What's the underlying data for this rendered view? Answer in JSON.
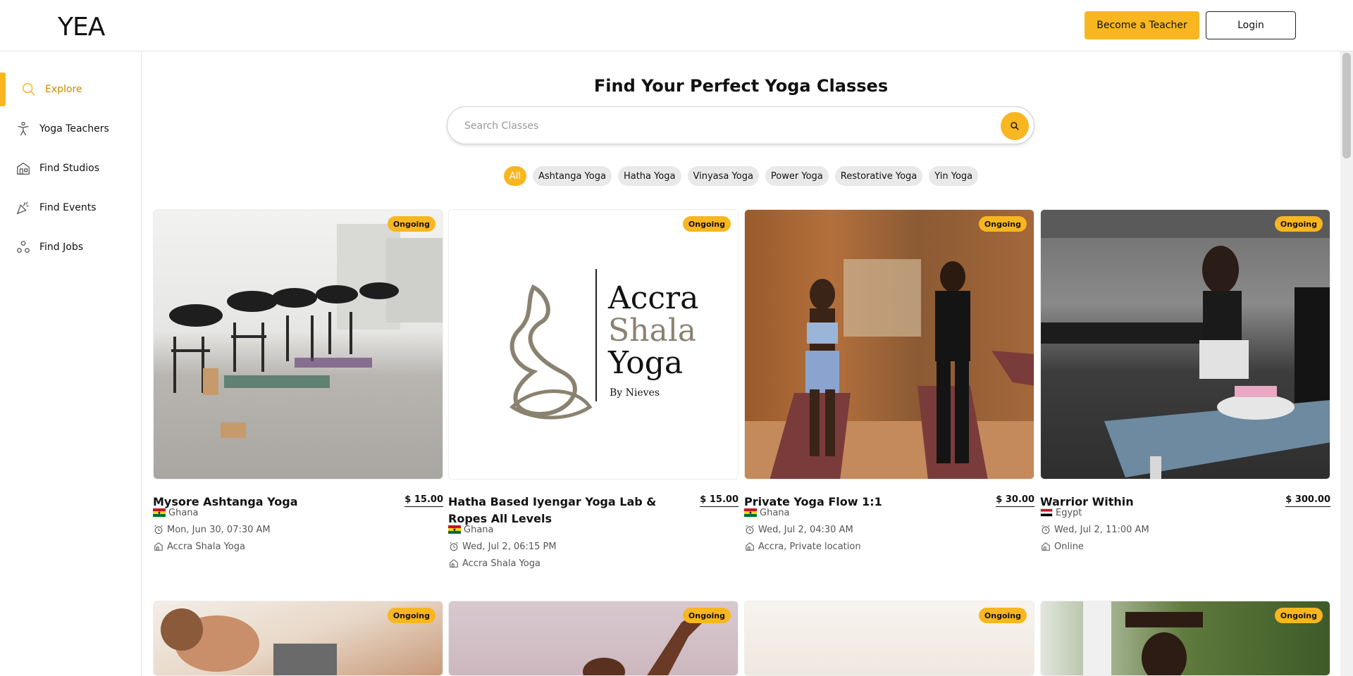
{
  "header": {
    "logo": "YEA",
    "become_teacher": "Become a Teacher",
    "login": "Login"
  },
  "sidebar": {
    "items": [
      {
        "label": "Explore",
        "icon": "search-icon",
        "active": true
      },
      {
        "label": "Yoga Teachers",
        "icon": "person-icon"
      },
      {
        "label": "Find Studios",
        "icon": "building-icon"
      },
      {
        "label": "Find Events",
        "icon": "party-icon"
      },
      {
        "label": "Find Jobs",
        "icon": "network-icon"
      }
    ]
  },
  "main": {
    "title": "Find Your Perfect Yoga Classes",
    "search_placeholder": "Search Classes",
    "filters": [
      "All",
      "Ashtanga Yoga",
      "Hatha Yoga",
      "Vinyasa Yoga",
      "Power Yoga",
      "Restorative Yoga",
      "Yin Yoga"
    ],
    "active_filter": "All"
  },
  "cards": [
    {
      "title": "Mysore Ashtanga Yoga",
      "price": "$ 15.00",
      "badge": "Ongoing",
      "country": "Ghana",
      "date": "Mon, Jun 30, 07:30 AM",
      "location": "Accra Shala Yoga"
    },
    {
      "title": "Hatha Based Iyengar Yoga Lab & Ropes All Levels",
      "price": "$ 15.00",
      "badge": "Ongoing",
      "country": "Ghana",
      "date": "Wed, Jul 2, 06:15 PM",
      "location": "Accra Shala Yoga",
      "logo": {
        "line1": "Accra",
        "line2": "Shala",
        "line3": "Yoga",
        "by": "By Nieves"
      }
    },
    {
      "title": "Private Yoga Flow 1:1",
      "price": "$ 30.00",
      "badge": "Ongoing",
      "country": "Ghana",
      "date": "Wed, Jul 2, 04:30 AM",
      "location": "Accra, Private location"
    },
    {
      "title": "Warrior Within",
      "price": "$ 300.00",
      "badge": "Ongoing",
      "country": "Egypt",
      "date": "Wed, Jul 2, 11:00 AM",
      "location": "Online"
    },
    {
      "badge": "Ongoing"
    },
    {
      "badge": "Ongoing"
    },
    {
      "badge": "Ongoing"
    },
    {
      "badge": "Ongoing"
    }
  ],
  "colors": {
    "accent": "#f8b620",
    "active_text": "#c98a05"
  }
}
